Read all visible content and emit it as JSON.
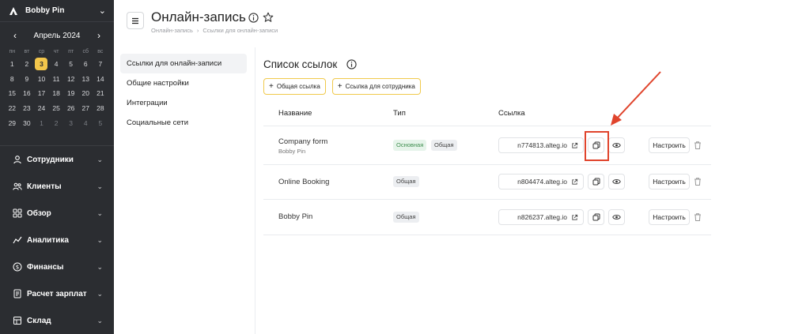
{
  "sidebar": {
    "company": "Bobby Pin",
    "calendar": {
      "month_label": "Апрель 2024",
      "weekdays": [
        "пн",
        "вт",
        "ср",
        "чт",
        "пт",
        "сб",
        "вс"
      ],
      "days": [
        {
          "d": "1",
          "muted": false
        },
        {
          "d": "2",
          "muted": false
        },
        {
          "d": "3",
          "muted": false,
          "today": true
        },
        {
          "d": "4",
          "muted": false
        },
        {
          "d": "5",
          "muted": false
        },
        {
          "d": "6",
          "muted": false
        },
        {
          "d": "7",
          "muted": false
        },
        {
          "d": "8",
          "muted": false
        },
        {
          "d": "9",
          "muted": false
        },
        {
          "d": "10",
          "muted": false
        },
        {
          "d": "11",
          "muted": false
        },
        {
          "d": "12",
          "muted": false
        },
        {
          "d": "13",
          "muted": false
        },
        {
          "d": "14",
          "muted": false
        },
        {
          "d": "15",
          "muted": false
        },
        {
          "d": "16",
          "muted": false
        },
        {
          "d": "17",
          "muted": false
        },
        {
          "d": "18",
          "muted": false
        },
        {
          "d": "19",
          "muted": false
        },
        {
          "d": "20",
          "muted": false
        },
        {
          "d": "21",
          "muted": false
        },
        {
          "d": "22",
          "muted": false
        },
        {
          "d": "23",
          "muted": false
        },
        {
          "d": "24",
          "muted": false
        },
        {
          "d": "25",
          "muted": false
        },
        {
          "d": "26",
          "muted": false
        },
        {
          "d": "27",
          "muted": false
        },
        {
          "d": "28",
          "muted": false
        },
        {
          "d": "29",
          "muted": false
        },
        {
          "d": "30",
          "muted": false
        },
        {
          "d": "1",
          "muted": true
        },
        {
          "d": "2",
          "muted": true
        },
        {
          "d": "3",
          "muted": true
        },
        {
          "d": "4",
          "muted": true
        },
        {
          "d": "5",
          "muted": true
        }
      ]
    },
    "nav": [
      {
        "label": "Сотрудники",
        "icon": "user-icon"
      },
      {
        "label": "Клиенты",
        "icon": "users-icon"
      },
      {
        "label": "Обзор",
        "icon": "grid-icon"
      },
      {
        "label": "Аналитика",
        "icon": "chart-icon"
      },
      {
        "label": "Финансы",
        "icon": "money-icon"
      },
      {
        "label": "Расчет зарплат",
        "icon": "payroll-icon"
      },
      {
        "label": "Склад",
        "icon": "warehouse-icon"
      }
    ]
  },
  "header": {
    "title": "Онлайн-запись",
    "breadcrumbs": [
      "Онлайн-запись",
      "Ссылки для онлайн-записи"
    ]
  },
  "settings_menu": [
    {
      "label": "Ссылки для онлайн-записи",
      "active": true
    },
    {
      "label": "Общие настройки",
      "active": false
    },
    {
      "label": "Интеграции",
      "active": false
    },
    {
      "label": "Социальные сети",
      "active": false
    }
  ],
  "content": {
    "title": "Список ссылок",
    "add_common_label": "Общая ссылка",
    "add_employee_label": "Ссылка для сотрудника",
    "columns": {
      "name": "Название",
      "type": "Тип",
      "link": "Ссылка"
    },
    "configure_label": "Настроить",
    "rows": [
      {
        "name": "Company form",
        "sub": "Bobby Pin",
        "tags": [
          "Основная",
          "Общая"
        ],
        "link": "n774813.alteg.io"
      },
      {
        "name": "Online Booking",
        "sub": "",
        "tags": [
          "Общая"
        ],
        "link": "n804474.alteg.io"
      },
      {
        "name": "Bobby Pin",
        "sub": "",
        "tags": [
          "Общая"
        ],
        "link": "n826237.alteg.io"
      }
    ]
  },
  "colors": {
    "sidebar_bg": "#2b2d31",
    "accent_yellow": "#f3c64b",
    "annotation_red": "#e0442c",
    "tag_main_green": "#3f8e4f"
  }
}
